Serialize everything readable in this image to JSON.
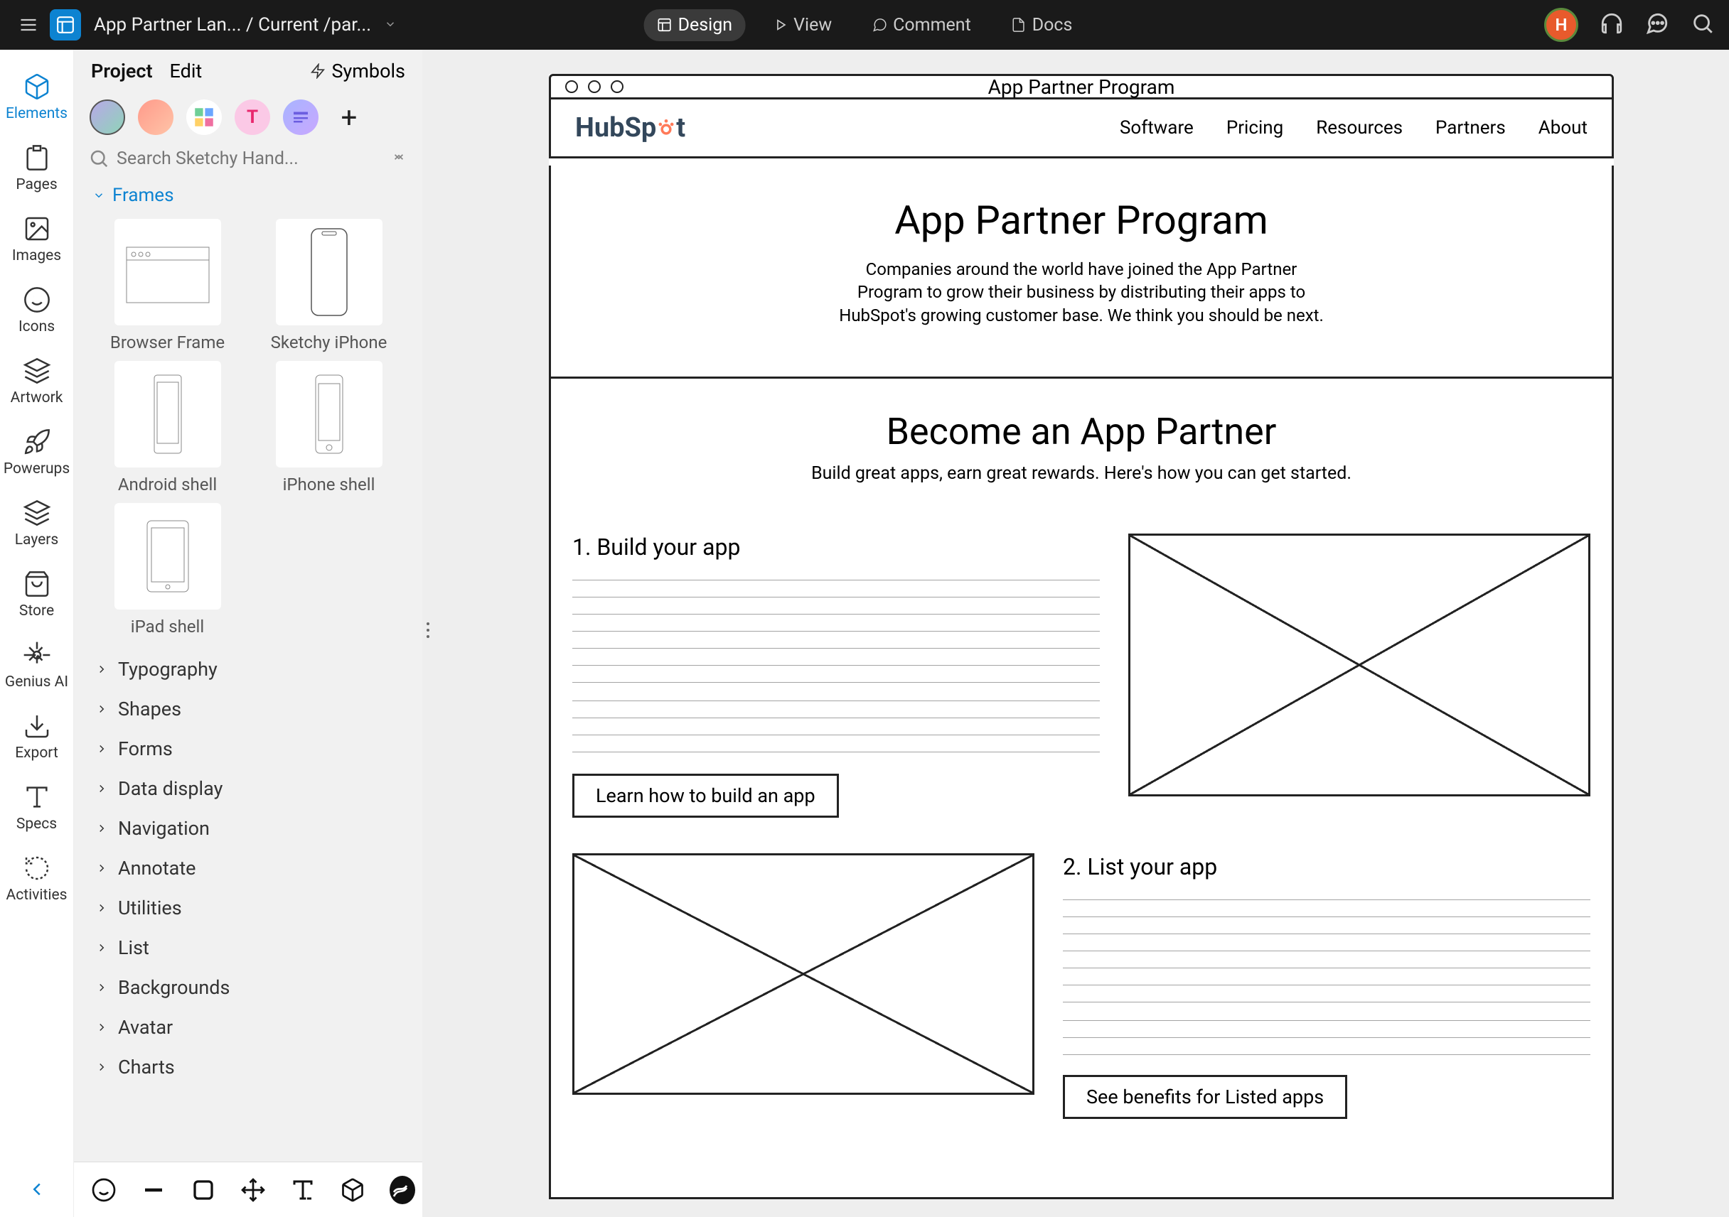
{
  "topbar": {
    "breadcrumb": "App Partner Lan... / Current /par...",
    "modes": {
      "design": "Design",
      "view": "View",
      "comment": "Comment",
      "docs": "Docs"
    },
    "avatar_letter": "H"
  },
  "rail": {
    "items": [
      "Elements",
      "Pages",
      "Images",
      "Icons",
      "Artwork",
      "Powerups",
      "Layers",
      "Store",
      "Genius AI",
      "Export",
      "Specs",
      "Activities"
    ]
  },
  "panel": {
    "tabs": {
      "project": "Project",
      "edit": "Edit"
    },
    "symbols": "Symbols",
    "search_placeholder": "Search Sketchy Hand...",
    "section_frames": "Frames",
    "frames": [
      "Browser Frame",
      "Sketchy iPhone",
      "Android shell",
      "iPhone shell",
      "iPad shell"
    ],
    "categories": [
      "Typography",
      "Shapes",
      "Forms",
      "Data display",
      "Navigation",
      "Annotate",
      "Utilities",
      "List",
      "Backgrounds",
      "Avatar",
      "Charts"
    ]
  },
  "canvas": {
    "browser_title": "App Partner Program",
    "brand": "HubSpot",
    "nav": [
      "Software",
      "Pricing",
      "Resources",
      "Partners",
      "About"
    ],
    "hero": {
      "title": "App Partner Program",
      "body": "Companies around the world have joined the App Partner Program to grow their business by distributing their apps to HubSpot's growing customer base. We think you should be next."
    },
    "become": {
      "title": "Become an App Partner",
      "sub": "Build great apps, earn great rewards. Here's how you can get started.",
      "step1": {
        "title": "1. Build your app",
        "cta": "Learn how to build an app"
      },
      "step2": {
        "title": "2. List your app",
        "cta": "See benefits for Listed apps"
      }
    }
  }
}
